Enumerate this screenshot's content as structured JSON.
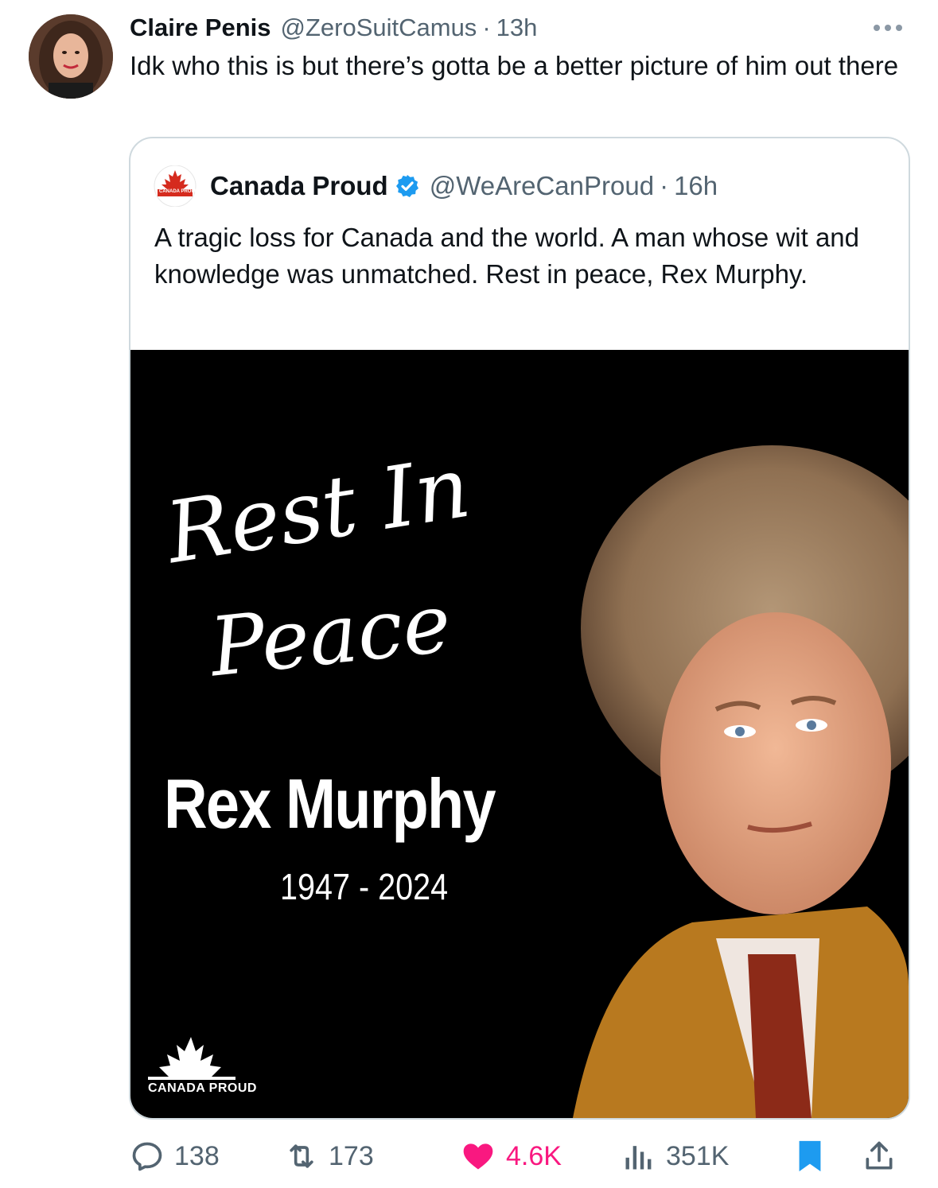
{
  "tweet": {
    "author_name": "Claire Penis",
    "author_handle": "@ZeroSuitCamus",
    "separator": "·",
    "time": "13h",
    "text": "Idk who this is but there’s gotta be a better picture of him out there"
  },
  "quoted_tweet": {
    "author_name": "Canada Proud",
    "author_handle": "@WeAreCanProud",
    "separator": "·",
    "time": "16h",
    "verified": true,
    "text": "A tragic loss for Canada and the world. A man whose wit and knowledge was unmatched. Rest in peace, Rex Murphy.",
    "logo_text": "CANADA PROUD",
    "image": {
      "script_line1": "Rest In",
      "script_line2": "Peace",
      "name": "Rex Murphy",
      "years": "1947 - 2024",
      "logo_text": "CANADA PROUD"
    }
  },
  "actions": {
    "replies": "138",
    "retweets": "173",
    "likes": "4.6K",
    "views": "351K"
  },
  "icons": [
    "more-icon",
    "verified-icon",
    "reply-icon",
    "retweet-icon",
    "heart-icon",
    "views-icon",
    "bookmark-icon",
    "share-icon"
  ],
  "colors": {
    "text": "#0f1419",
    "secondary": "#536471",
    "like": "#f91880",
    "verified": "#1d9bf0",
    "bookmark": "#1d9bf0",
    "border": "#cfd9de",
    "maple": "#d52b1e"
  }
}
